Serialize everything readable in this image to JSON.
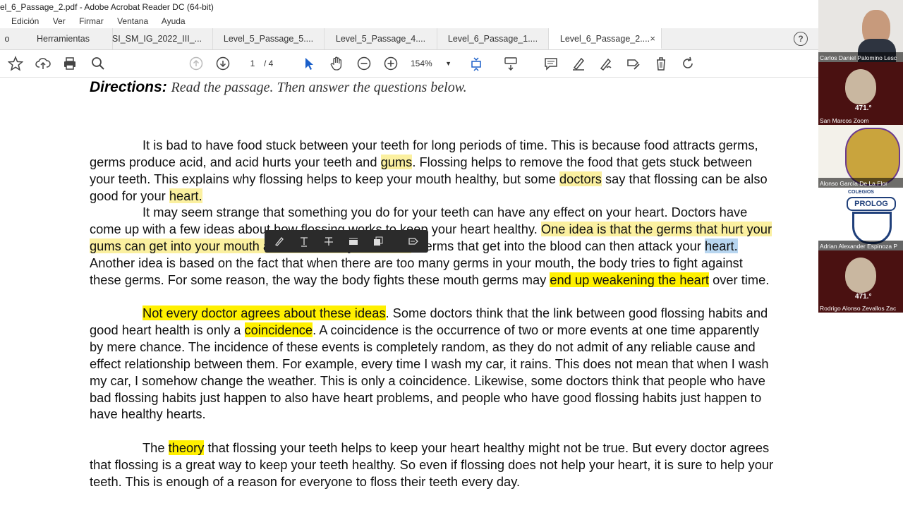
{
  "window": {
    "title": "el_6_Passage_2.pdf - Adobe Acrobat Reader DC (64-bit)"
  },
  "menu": [
    "Edición",
    "Ver",
    "Firmar",
    "Ventana",
    "Ayuda"
  ],
  "tabs": {
    "partial": "o",
    "tools": "Herramientas",
    "t1": "SI_SM_IG_2022_III_...",
    "t2": "Level_5_Passage_5....",
    "t3": "Level_5_Passage_4....",
    "t4": "Level_6_Passage_1....",
    "t5": "Level_6_Passage_2....",
    "close": "×",
    "help": "?"
  },
  "toolbar": {
    "page_current": "1",
    "page_total": "/ 4",
    "zoom": "154%"
  },
  "doc": {
    "dir_label": "Directions:",
    "dir_text": "Read the passage. Then answer the questions below.",
    "p1a": "It is bad to have food stuck between your teeth for long periods of time. This is because food attracts germs, germs produce acid, and acid hurts your teeth and ",
    "p1b": "gums",
    "p1c": ". Flossing helps to remove the food that gets stuck between your teeth. This explains why flossing helps to keep your mouth healthy, but some ",
    "p1d": "doctors",
    "p1e": " say that flossing can be also good for your ",
    "p1f": "heart.",
    "p2a": "It may seem strange that something you do for your teeth can have any effect on your heart. Doctors have come up with a few ideas about how flossing works to keep your heart healthy. ",
    "p2b": "One idea is that the germs that hurt your gums can get into your mouth and travel into your blood.",
    "p2c": " Germs that get into the blood can then attack your ",
    "p2d": "heart.",
    "p2e": " Another idea is based on the fact that when there are too many germs in your mouth, the body tries to fight against these germs. For some reason, the way the body fights these mouth germs may ",
    "p2f": "end up weakening the heart",
    "p2g": " over time.",
    "p3a": "Not every doctor agrees about these ideas",
    "p3b": ". Some doctors think that the link between good flossing habits and good heart health is only a ",
    "p3c": "coincidence",
    "p3d": ". A coincidence is the occurrence of two or more events at one time apparently by mere chance. The incidence of these events is completely random, as they do not admit of any reliable cause and effect relationship between them. For example, every time I wash my car, it rains. This does not mean that when I wash my car, I somehow change the weather. This is only a coincidence. Likewise, some doctors think that people who have bad flossing habits just happen to also have heart problems, and people who have good flossing habits just happen to have healthy hearts.",
    "p4a": "The ",
    "p4b": "theory",
    "p4c": " that flossing your teeth helps to keep your heart healthy might not be true. But every doctor agrees that flossing is a great way to keep your teeth healthy. So even if flossing does not help your heart, it is sure to help your teeth. This is enough of a reason for everyone to floss their teeth every day."
  },
  "participants": [
    {
      "name": "Carlos Daniel Palomino Lesc"
    },
    {
      "name": "San Marcos Zoom"
    },
    {
      "name": "Alonso García De La Flor"
    },
    {
      "name": "Adrian Alexander Espinoza P"
    },
    {
      "name": "Rodrigo Alonso Zevallos Zac"
    }
  ],
  "emblem": {
    "text": "471.°",
    "college_label": "COLEGIOS",
    "college_name": "PROLOG"
  },
  "colors": {
    "highlight": "#fff000",
    "highlight_soft": "#fbf0a0",
    "selection": "#b8d6f0",
    "video_bg": "#4a1111"
  }
}
